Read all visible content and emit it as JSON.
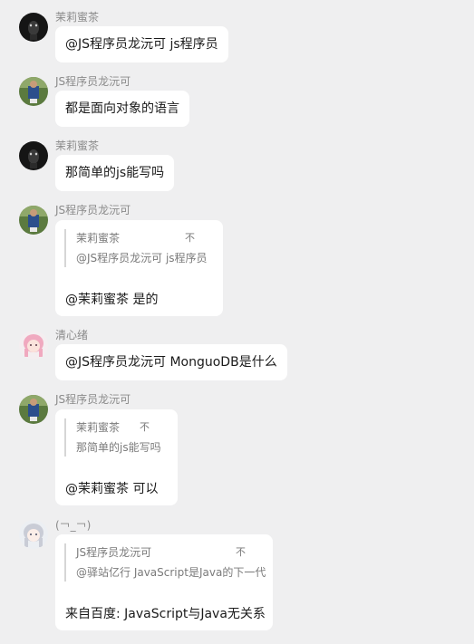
{
  "messages": [
    {
      "sender": "茉莉蜜茶",
      "avatar": "black-dog-avatar",
      "text": "@JS程序员龙沅可 js程序员"
    },
    {
      "sender": "JS程序员龙沅可",
      "avatar": "outdoor-photo-avatar",
      "text": "都是面向对象的语言"
    },
    {
      "sender": "茉莉蜜茶",
      "avatar": "black-dog-avatar",
      "text": "那简单的js能写吗"
    },
    {
      "sender": "JS程序员龙沅可",
      "avatar": "outdoor-photo-avatar",
      "reply": {
        "author": "茉莉蜜茶",
        "icon_label": "不",
        "text": "@JS程序员龙沅可 js程序员"
      },
      "text": "@茉莉蜜茶 是的"
    },
    {
      "sender": "清心绪",
      "avatar": "anime-pink-hair-avatar",
      "text": "@JS程序员龙沅可 MonguoDB是什么"
    },
    {
      "sender": "JS程序员龙沅可",
      "avatar": "outdoor-photo-avatar",
      "reply": {
        "author": "茉莉蜜茶",
        "icon_label": "不",
        "text": "那简单的js能写吗"
      },
      "text": "@茉莉蜜茶 可以"
    },
    {
      "sender": "(￢_￢)",
      "avatar": "anime-silver-hair-avatar",
      "reply": {
        "author": "JS程序员龙沅可",
        "icon_label": "不",
        "text": "@驿站亿行 JavaScript是Java的下一代"
      },
      "text": "来自百度: JavaScript与Java无关系"
    }
  ],
  "colors": {
    "background": "#efeff0",
    "bubble": "#ffffff",
    "name_text": "#8a8a8a",
    "quote_bar": "#d6d6d6"
  }
}
